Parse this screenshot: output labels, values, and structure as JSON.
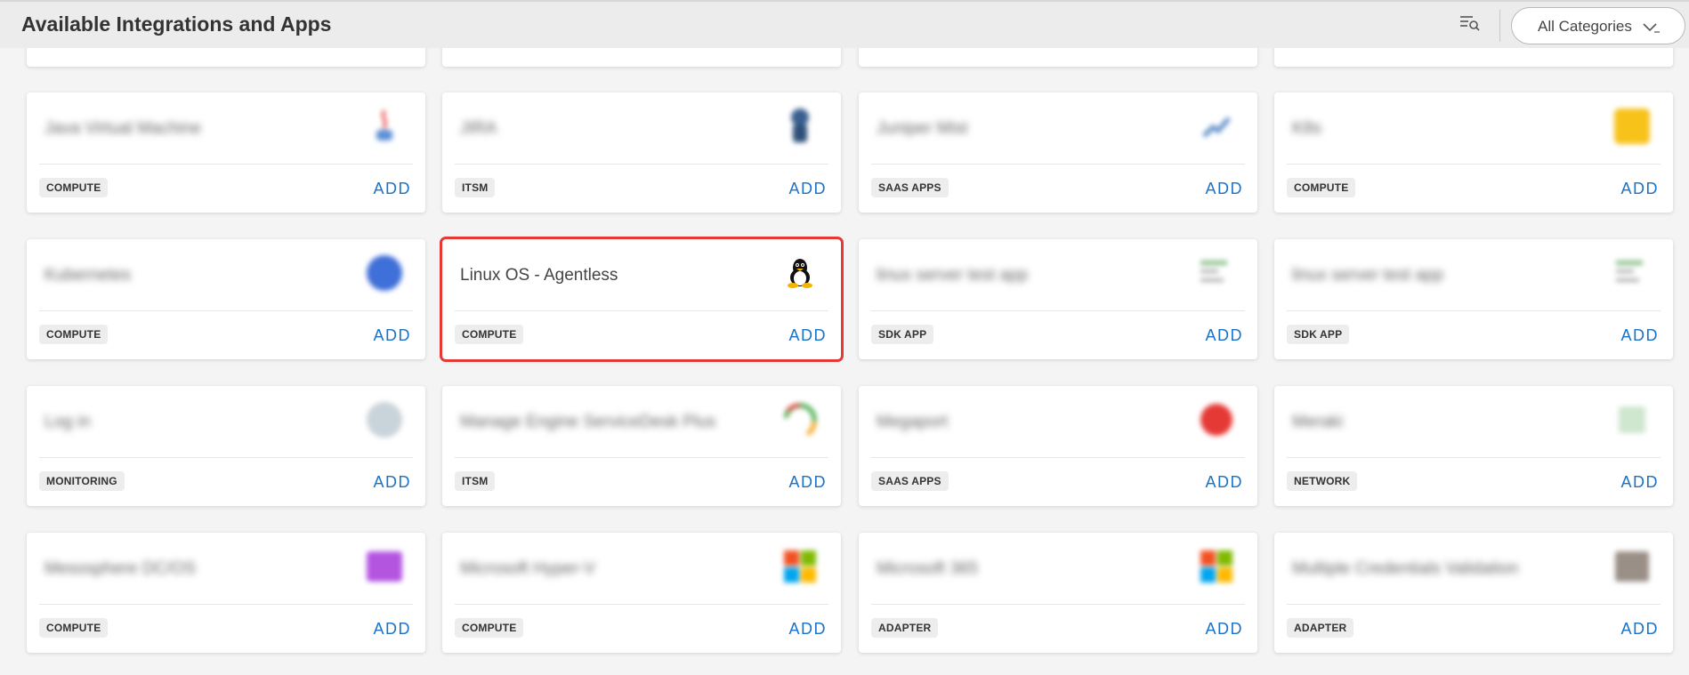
{
  "header": {
    "title": "Available Integrations and Apps",
    "category_select": "All Categories"
  },
  "add_label": "ADD",
  "top_partial_row": [
    {
      "category": ""
    },
    {
      "category": ""
    },
    {
      "category": ""
    },
    {
      "category": ""
    }
  ],
  "cards": [
    {
      "title": "Java Virtual Machine",
      "category": "COMPUTE",
      "icon": "java-icon"
    },
    {
      "title": "JIRA",
      "category": "ITSM",
      "icon": "jira-icon"
    },
    {
      "title": "Juniper Mist",
      "category": "SAAS APPS",
      "icon": "juniper-icon"
    },
    {
      "title": "K8s",
      "category": "COMPUTE",
      "icon": "k8s-icon"
    },
    {
      "title": "Kubernetes",
      "category": "COMPUTE",
      "icon": "kubernetes-icon"
    },
    {
      "title": "Linux OS - Agentless",
      "category": "COMPUTE",
      "icon": "linux-tux-icon"
    },
    {
      "title": "linux server test app",
      "category": "SDK APP",
      "icon": "sdk-app-icon"
    },
    {
      "title": "linux server test app",
      "category": "SDK APP",
      "icon": "sdk-app-icon"
    },
    {
      "title": "Log in",
      "category": "MONITORING",
      "icon": "login-icon"
    },
    {
      "title": "Manage Engine ServiceDesk Plus",
      "category": "ITSM",
      "icon": "manageengine-icon"
    },
    {
      "title": "Megaport",
      "category": "SAAS APPS",
      "icon": "megaport-icon"
    },
    {
      "title": "Meraki",
      "category": "NETWORK",
      "icon": "meraki-icon"
    },
    {
      "title": "Mesosphere DC/OS",
      "category": "COMPUTE",
      "icon": "mesosphere-icon"
    },
    {
      "title": "Microsoft Hyper-V",
      "category": "COMPUTE",
      "icon": "microsoft-icon"
    },
    {
      "title": "Microsoft 365",
      "category": "ADAPTER",
      "icon": "microsoft-icon"
    },
    {
      "title": "Multiple Credentials Validation",
      "category": "ADAPTER",
      "icon": "credentials-icon"
    }
  ]
}
